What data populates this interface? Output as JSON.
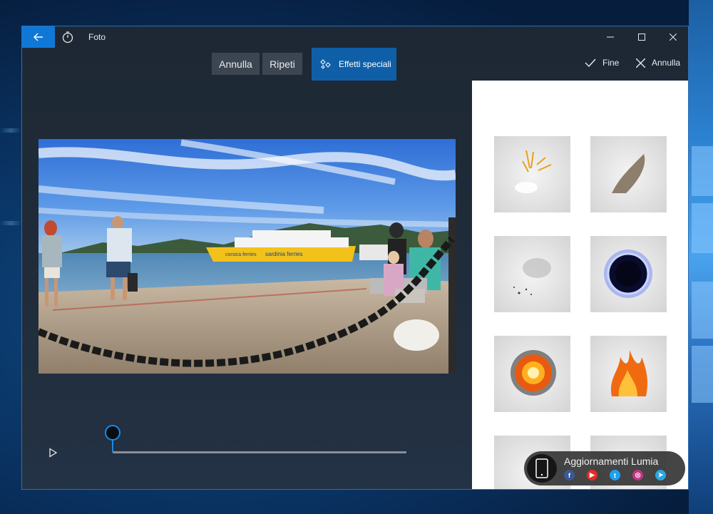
{
  "window": {
    "title": "Foto"
  },
  "toolbar": {
    "undo_label": "Annulla",
    "redo_label": "Ripeti",
    "effects_label": "Effetti speciali",
    "done_label": "Fine",
    "cancel_label": "Annulla"
  },
  "photo": {
    "ferry_text_left": "corsica ferries",
    "ferry_text_right": "sardinia ferries"
  },
  "playback": {
    "progress": 0.0
  },
  "effects": [
    {
      "name": "sparks-effect"
    },
    {
      "name": "smoke-burst-effect"
    },
    {
      "name": "debris-effect"
    },
    {
      "name": "portal-effect"
    },
    {
      "name": "explosion-effect"
    },
    {
      "name": "fire-effect"
    },
    {
      "name": "effect-7"
    },
    {
      "name": "effect-8"
    }
  ],
  "watermark": {
    "text": "Aggiornamenti Lumia",
    "icons": [
      "facebook-icon",
      "youtube-icon",
      "twitter-icon",
      "instagram-icon",
      "telegram-icon"
    ]
  },
  "colors": {
    "accent": "#0f78d7",
    "effects_button": "#0f5fa8",
    "window_bg": "#202c3a",
    "button_bg": "#3c4652"
  }
}
